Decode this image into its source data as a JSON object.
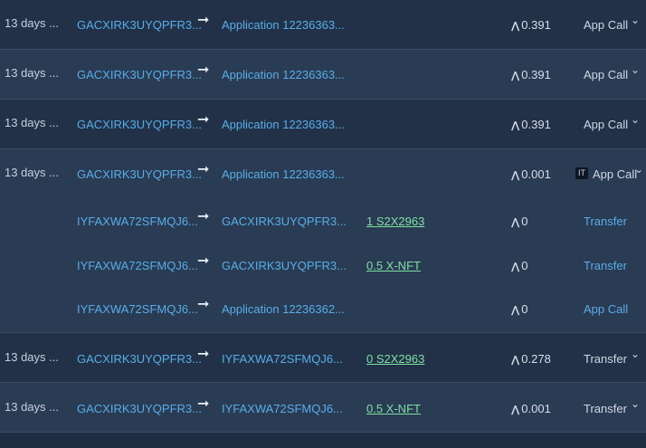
{
  "rows": [
    {
      "age": "13 days ...",
      "from": "GACXIRK3UYQPFR3...",
      "to": "Application 12236363...",
      "asset": "",
      "fee": "0.391",
      "type": "App Call"
    },
    {
      "age": "13 days ...",
      "from": "GACXIRK3UYQPFR3...",
      "to": "Application 12236363...",
      "asset": "",
      "fee": "0.391",
      "type": "App Call"
    },
    {
      "age": "13 days ...",
      "from": "GACXIRK3UYQPFR3...",
      "to": "Application 12236363...",
      "asset": "",
      "fee": "0.391",
      "type": "App Call"
    }
  ],
  "group": {
    "parent": {
      "age": "13 days ...",
      "from": "GACXIRK3UYQPFR3...",
      "to": "Application 12236363...",
      "asset": "",
      "fee": "0.001",
      "badge": "IT",
      "type": "App Call"
    },
    "children": [
      {
        "from": "IYFAXWA72SFMQJ6...",
        "to": "GACXIRK3UYQPFR3...",
        "asset": "1 S2X2963",
        "fee": "0",
        "type": "Transfer"
      },
      {
        "from": "IYFAXWA72SFMQJ6...",
        "to": "GACXIRK3UYQPFR3...",
        "asset": "0.5 X-NFT",
        "fee": "0",
        "type": "Transfer"
      },
      {
        "from": "IYFAXWA72SFMQJ6...",
        "to": "Application 12236362...",
        "asset": "",
        "fee": "0",
        "type": "App Call"
      }
    ]
  },
  "rows_after": [
    {
      "age": "13 days ...",
      "from": "GACXIRK3UYQPFR3...",
      "to": "IYFAXWA72SFMQJ6...",
      "asset": "0 S2X2963",
      "fee": "0.278",
      "type": "Transfer"
    },
    {
      "age": "13 days ...",
      "from": "GACXIRK3UYQPFR3...",
      "to": "IYFAXWA72SFMQJ6...",
      "asset": "0.5 X-NFT",
      "fee": "0.001",
      "type": "Transfer"
    }
  ],
  "icons": {
    "arrow": "➞",
    "algo": "⋀",
    "chevron": "⌄"
  }
}
